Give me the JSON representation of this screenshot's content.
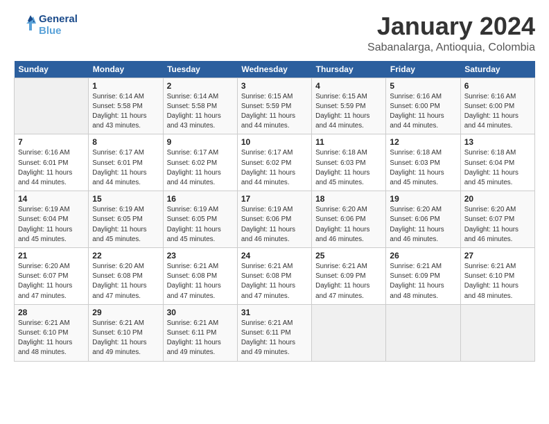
{
  "logo": {
    "line1": "General",
    "line2": "Blue"
  },
  "title": "January 2024",
  "subtitle": "Sabanalarga, Antioquia, Colombia",
  "headers": [
    "Sunday",
    "Monday",
    "Tuesday",
    "Wednesday",
    "Thursday",
    "Friday",
    "Saturday"
  ],
  "weeks": [
    [
      {
        "day": "",
        "info": ""
      },
      {
        "day": "1",
        "info": "Sunrise: 6:14 AM\nSunset: 5:58 PM\nDaylight: 11 hours\nand 43 minutes."
      },
      {
        "day": "2",
        "info": "Sunrise: 6:14 AM\nSunset: 5:58 PM\nDaylight: 11 hours\nand 43 minutes."
      },
      {
        "day": "3",
        "info": "Sunrise: 6:15 AM\nSunset: 5:59 PM\nDaylight: 11 hours\nand 44 minutes."
      },
      {
        "day": "4",
        "info": "Sunrise: 6:15 AM\nSunset: 5:59 PM\nDaylight: 11 hours\nand 44 minutes."
      },
      {
        "day": "5",
        "info": "Sunrise: 6:16 AM\nSunset: 6:00 PM\nDaylight: 11 hours\nand 44 minutes."
      },
      {
        "day": "6",
        "info": "Sunrise: 6:16 AM\nSunset: 6:00 PM\nDaylight: 11 hours\nand 44 minutes."
      }
    ],
    [
      {
        "day": "7",
        "info": "Sunrise: 6:16 AM\nSunset: 6:01 PM\nDaylight: 11 hours\nand 44 minutes."
      },
      {
        "day": "8",
        "info": "Sunrise: 6:17 AM\nSunset: 6:01 PM\nDaylight: 11 hours\nand 44 minutes."
      },
      {
        "day": "9",
        "info": "Sunrise: 6:17 AM\nSunset: 6:02 PM\nDaylight: 11 hours\nand 44 minutes."
      },
      {
        "day": "10",
        "info": "Sunrise: 6:17 AM\nSunset: 6:02 PM\nDaylight: 11 hours\nand 44 minutes."
      },
      {
        "day": "11",
        "info": "Sunrise: 6:18 AM\nSunset: 6:03 PM\nDaylight: 11 hours\nand 45 minutes."
      },
      {
        "day": "12",
        "info": "Sunrise: 6:18 AM\nSunset: 6:03 PM\nDaylight: 11 hours\nand 45 minutes."
      },
      {
        "day": "13",
        "info": "Sunrise: 6:18 AM\nSunset: 6:04 PM\nDaylight: 11 hours\nand 45 minutes."
      }
    ],
    [
      {
        "day": "14",
        "info": "Sunrise: 6:19 AM\nSunset: 6:04 PM\nDaylight: 11 hours\nand 45 minutes."
      },
      {
        "day": "15",
        "info": "Sunrise: 6:19 AM\nSunset: 6:05 PM\nDaylight: 11 hours\nand 45 minutes."
      },
      {
        "day": "16",
        "info": "Sunrise: 6:19 AM\nSunset: 6:05 PM\nDaylight: 11 hours\nand 45 minutes."
      },
      {
        "day": "17",
        "info": "Sunrise: 6:19 AM\nSunset: 6:06 PM\nDaylight: 11 hours\nand 46 minutes."
      },
      {
        "day": "18",
        "info": "Sunrise: 6:20 AM\nSunset: 6:06 PM\nDaylight: 11 hours\nand 46 minutes."
      },
      {
        "day": "19",
        "info": "Sunrise: 6:20 AM\nSunset: 6:06 PM\nDaylight: 11 hours\nand 46 minutes."
      },
      {
        "day": "20",
        "info": "Sunrise: 6:20 AM\nSunset: 6:07 PM\nDaylight: 11 hours\nand 46 minutes."
      }
    ],
    [
      {
        "day": "21",
        "info": "Sunrise: 6:20 AM\nSunset: 6:07 PM\nDaylight: 11 hours\nand 47 minutes."
      },
      {
        "day": "22",
        "info": "Sunrise: 6:20 AM\nSunset: 6:08 PM\nDaylight: 11 hours\nand 47 minutes."
      },
      {
        "day": "23",
        "info": "Sunrise: 6:21 AM\nSunset: 6:08 PM\nDaylight: 11 hours\nand 47 minutes."
      },
      {
        "day": "24",
        "info": "Sunrise: 6:21 AM\nSunset: 6:08 PM\nDaylight: 11 hours\nand 47 minutes."
      },
      {
        "day": "25",
        "info": "Sunrise: 6:21 AM\nSunset: 6:09 PM\nDaylight: 11 hours\nand 47 minutes."
      },
      {
        "day": "26",
        "info": "Sunrise: 6:21 AM\nSunset: 6:09 PM\nDaylight: 11 hours\nand 48 minutes."
      },
      {
        "day": "27",
        "info": "Sunrise: 6:21 AM\nSunset: 6:10 PM\nDaylight: 11 hours\nand 48 minutes."
      }
    ],
    [
      {
        "day": "28",
        "info": "Sunrise: 6:21 AM\nSunset: 6:10 PM\nDaylight: 11 hours\nand 48 minutes."
      },
      {
        "day": "29",
        "info": "Sunrise: 6:21 AM\nSunset: 6:10 PM\nDaylight: 11 hours\nand 49 minutes."
      },
      {
        "day": "30",
        "info": "Sunrise: 6:21 AM\nSunset: 6:11 PM\nDaylight: 11 hours\nand 49 minutes."
      },
      {
        "day": "31",
        "info": "Sunrise: 6:21 AM\nSunset: 6:11 PM\nDaylight: 11 hours\nand 49 minutes."
      },
      {
        "day": "",
        "info": ""
      },
      {
        "day": "",
        "info": ""
      },
      {
        "day": "",
        "info": ""
      }
    ]
  ]
}
